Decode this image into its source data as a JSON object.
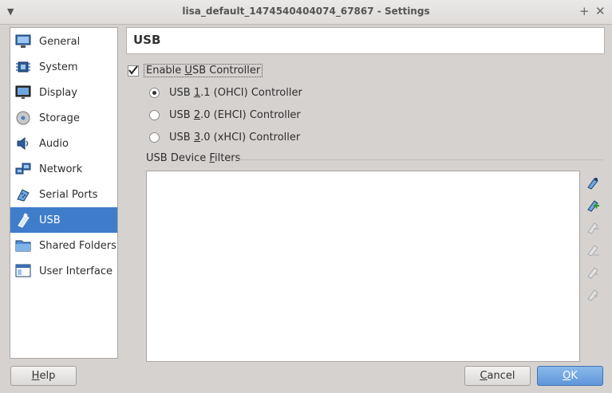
{
  "window": {
    "title": "lisa_default_1474540404074_67867 - Settings",
    "menu_icon": "chevron-down-icon",
    "pin_icon": "plus-icon",
    "close_icon": "close-icon"
  },
  "sidebar": {
    "items": [
      {
        "label": "General",
        "icon": "monitor-icon"
      },
      {
        "label": "System",
        "icon": "chip-icon"
      },
      {
        "label": "Display",
        "icon": "display-icon"
      },
      {
        "label": "Storage",
        "icon": "disk-icon"
      },
      {
        "label": "Audio",
        "icon": "speaker-icon"
      },
      {
        "label": "Network",
        "icon": "network-icon"
      },
      {
        "label": "Serial Ports",
        "icon": "serial-port-icon"
      },
      {
        "label": "USB",
        "icon": "usb-icon",
        "selected": true
      },
      {
        "label": "Shared Folders",
        "icon": "folder-icon"
      },
      {
        "label": "User Interface",
        "icon": "window-icon"
      }
    ]
  },
  "page": {
    "title": "USB",
    "enable_usb": {
      "pre": "Enable ",
      "u": "U",
      "post": "SB Controller",
      "checked": true
    },
    "radios": [
      {
        "pre": "USB ",
        "u": "1",
        "post": ".1 (OHCI) Controller",
        "checked": true
      },
      {
        "pre": "USB ",
        "u": "2",
        "post": ".0 (EHCI) Controller",
        "checked": false
      },
      {
        "pre": "USB ",
        "u": "3",
        "post": ".0 (xHCI) Controller",
        "checked": false
      }
    ],
    "filters_label": {
      "pre": "USB Device ",
      "u": "F",
      "post": "ilters"
    },
    "filter_tools": [
      {
        "icon": "filter-edit-icon",
        "enabled": true
      },
      {
        "icon": "filter-add-icon",
        "enabled": true
      },
      {
        "icon": "filter-remove-icon",
        "enabled": false
      },
      {
        "icon": "filter-edit-disabled-icon",
        "enabled": false
      },
      {
        "icon": "filter-move-up-icon",
        "enabled": false
      },
      {
        "icon": "filter-move-down-icon",
        "enabled": false
      }
    ]
  },
  "buttons": {
    "help": {
      "u": "H",
      "post": "elp"
    },
    "cancel": {
      "u": "C",
      "post": "ancel"
    },
    "ok": {
      "u": "O",
      "post": "K"
    }
  },
  "colors": {
    "accent": "#3f7dcb",
    "background": "#d6d2d0"
  }
}
